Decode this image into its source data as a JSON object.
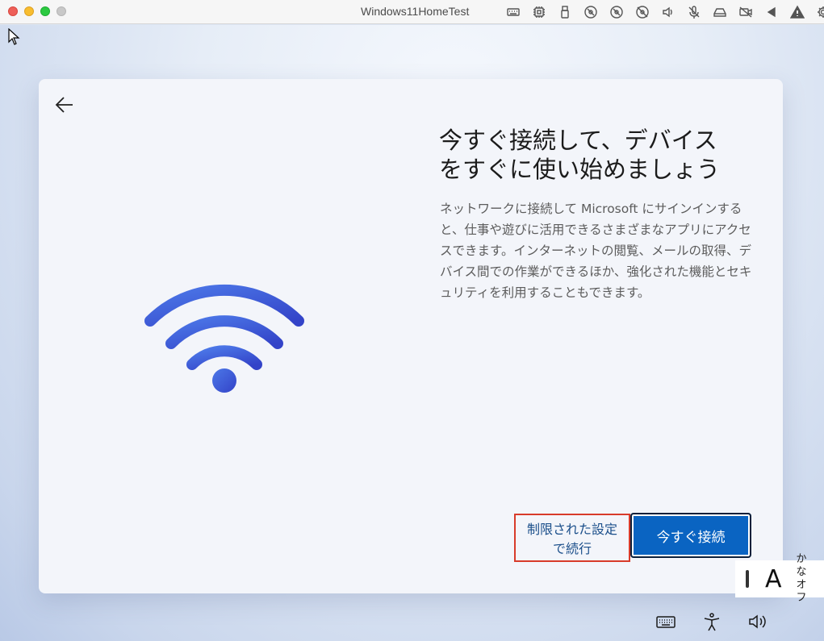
{
  "window": {
    "title": "Windows11HomeTest"
  },
  "titlebar_icons": [
    "keyboard-icon",
    "cpu-icon",
    "usb-icon",
    "disc-icon",
    "disc2-icon",
    "disc-off-icon",
    "speaker-icon",
    "mic-off-icon",
    "drive-icon",
    "camera-off-icon",
    "play-back-icon",
    "warning-icon",
    "gear-icon"
  ],
  "oobe": {
    "heading": "今すぐ接続して、デバイス\nをすぐに使い始めましょう",
    "description": "ネットワークに接続して Microsoft にサインインすると、仕事や遊びに活用できるさまざまなアプリにアクセスできます。インターネットの閲覧、メールの取得、デバイス間での作業ができるほか、強化された機能とセキュリティを利用することもできます。",
    "limited_button": "制限された設定\nで続行",
    "connect_button": "今すぐ接続",
    "wifi_color": "#3b5ed8"
  },
  "ime": {
    "mode": "A",
    "kana": "かな\nオフ"
  },
  "taskbar_icons": [
    "keyboard-icon",
    "accessibility-icon",
    "volume-icon"
  ]
}
